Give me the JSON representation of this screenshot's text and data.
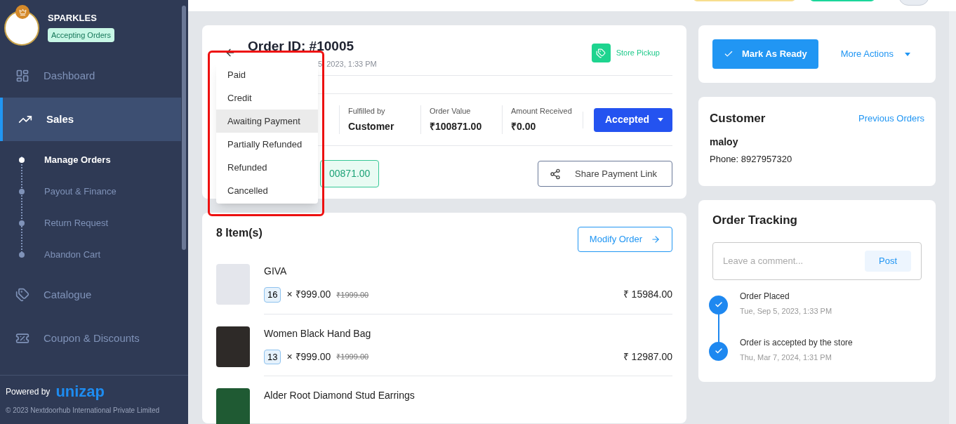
{
  "store": {
    "name": "SPARKLES",
    "status": "Accepting Orders"
  },
  "sidebar": {
    "items": [
      {
        "label": "Dashboard",
        "selected": false
      },
      {
        "label": "Sales",
        "selected": true,
        "children": [
          {
            "label": "Manage Orders",
            "selected": true
          },
          {
            "label": "Payout & Finance",
            "selected": false
          },
          {
            "label": "Return Request",
            "selected": false
          },
          {
            "label": "Abandon Cart",
            "selected": false
          }
        ]
      },
      {
        "label": "Catalogue",
        "selected": false
      },
      {
        "label": "Coupon & Discounts",
        "selected": false
      }
    ],
    "powered_by": "Powered by",
    "logo": "unizap",
    "copyright": "© 2023 Nextdoorhub International Private Limited"
  },
  "order": {
    "title": "Order ID: #10005",
    "date": "5, 2023, 1:33 PM",
    "delivery": "Store Pickup",
    "stats": [
      {
        "label": "Fulfilled by",
        "value": "Customer"
      },
      {
        "label": "Order Value",
        "value": "₹100871.00"
      },
      {
        "label": "Amount Received",
        "value": "₹0.00"
      }
    ],
    "status": "Accepted",
    "payment_amount": "00871.00",
    "share_button": "Share Payment Link"
  },
  "payment_menu": {
    "options": [
      {
        "label": "Paid",
        "selected": false
      },
      {
        "label": "Credit",
        "selected": false
      },
      {
        "label": "Awaiting Payment",
        "selected": true
      },
      {
        "label": "Partially Refunded",
        "selected": false
      },
      {
        "label": "Refunded",
        "selected": false
      },
      {
        "label": "Cancelled",
        "selected": false
      }
    ]
  },
  "items": {
    "title": "8 Item(s)",
    "modify_button": "Modify Order",
    "rows": [
      {
        "name": "GIVA",
        "quantity": "16",
        "price": "× ₹999.00",
        "original_price": "₹1999.00",
        "total": "₹ 15984.00"
      },
      {
        "name": "Women Black Hand Bag",
        "quantity": "13",
        "price": "× ₹999.00",
        "original_price": "₹1999.00",
        "total": "₹ 12987.00"
      },
      {
        "name": "Alder Root Diamond Stud Earrings"
      }
    ]
  },
  "actions": {
    "primary": "Mark As Ready",
    "more": "More Actions"
  },
  "customer": {
    "title": "Customer",
    "link": "Previous Orders",
    "name": "maloy",
    "phone": "Phone: 8927957320"
  },
  "tracking": {
    "title": "Order Tracking",
    "placeholder": "Leave a comment...",
    "post_button": "Post",
    "events": [
      {
        "title": "Order Placed",
        "time": "Tue, Sep 5, 2023, 1:33 PM"
      },
      {
        "title": "Order is accepted by the store",
        "time": "Thu, Mar 7, 2024, 1:31 PM"
      }
    ]
  }
}
